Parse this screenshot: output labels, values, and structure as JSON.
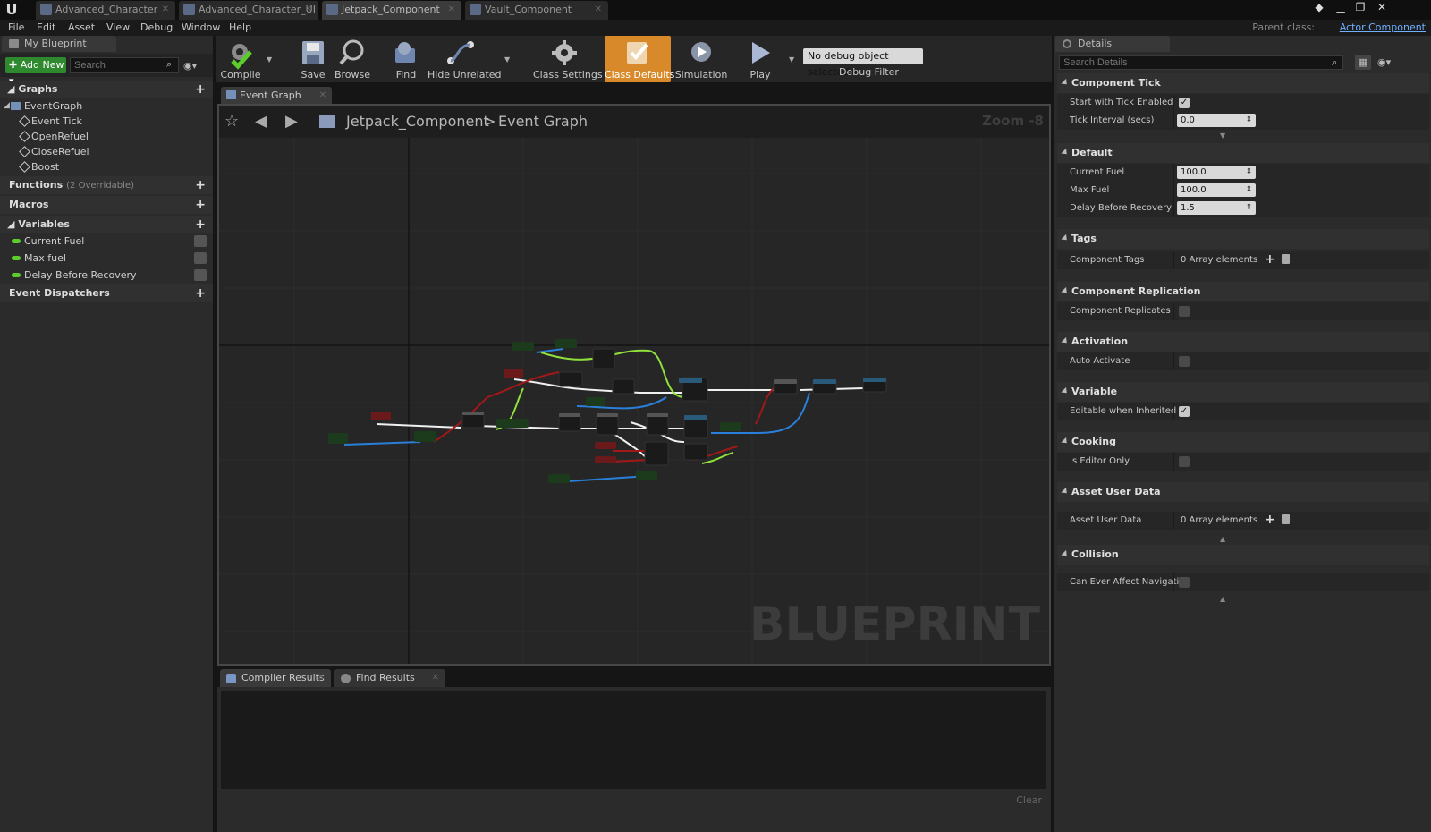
{
  "titlebar": {
    "tabs": [
      {
        "label": "Advanced_Character"
      },
      {
        "label": "Advanced_Character_UI"
      },
      {
        "label": "Jetpack_Component"
      },
      {
        "label": "Vault_Component"
      }
    ]
  },
  "menu": {
    "items": [
      "File",
      "Edit",
      "Asset",
      "View",
      "Debug",
      "Window",
      "Help"
    ],
    "parent_class_label": "Parent class:",
    "parent_class_value": "Actor Component"
  },
  "left_panel": {
    "tab_label": "My Blueprint",
    "add_new_label": "Add New",
    "search_placeholder": "Search",
    "graphs": {
      "header": "Graphs",
      "root": "EventGraph",
      "items": [
        "Event Tick",
        "OpenRefuel",
        "CloseRefuel",
        "Boost"
      ]
    },
    "functions": {
      "header": "Functions",
      "sub": "(2 Overridable)"
    },
    "macros": {
      "header": "Macros"
    },
    "variables": {
      "header": "Variables",
      "items": [
        "Current Fuel",
        "Max fuel",
        "Delay Before Recovery"
      ],
      "pill_color": "#5bcc2b"
    },
    "event_dispatchers": {
      "header": "Event Dispatchers"
    }
  },
  "toolbar": {
    "buttons": [
      {
        "label": "Compile",
        "icon": "compile-icon"
      },
      {
        "label": "Save",
        "icon": "save-icon"
      },
      {
        "label": "Browse",
        "icon": "browse-icon"
      },
      {
        "label": "Find",
        "icon": "find-icon"
      },
      {
        "label": "Hide Unrelated",
        "icon": "hide-unrelated-icon"
      },
      {
        "label": "Class Settings",
        "icon": "class-settings-icon"
      },
      {
        "label": "Class Defaults",
        "icon": "class-defaults-icon"
      },
      {
        "label": "Simulation",
        "icon": "simulation-icon"
      },
      {
        "label": "Play",
        "icon": "play-icon"
      }
    ],
    "active_button": "Class Defaults",
    "active_color": "#d88a2a",
    "debug_select": "No debug object selected",
    "debug_filter_label": "Debug Filter"
  },
  "graph": {
    "tab_label": "Event Graph",
    "breadcrumb_class": "Jetpack_Component",
    "breadcrumb_sep": ">",
    "breadcrumb_graph": "Event Graph",
    "zoom": "Zoom -8",
    "watermark": "BLUEPRINT",
    "wire_colors": {
      "exec": "#f0f0f0",
      "float": "#8fe03c",
      "object": "#2a7fd8",
      "bool": "#a01818"
    }
  },
  "bottom": {
    "tabs": [
      "Compiler Results",
      "Find Results"
    ],
    "clear_label": "Clear"
  },
  "details": {
    "tab_label": "Details",
    "search_placeholder": "Search Details",
    "categories": {
      "component_tick": {
        "header": "Component Tick",
        "start_tick_label": "Start with Tick Enabled",
        "start_tick_checked": true,
        "tick_interval_label": "Tick Interval (secs)",
        "tick_interval_value": "0.0"
      },
      "default": {
        "header": "Default",
        "current_fuel_label": "Current Fuel",
        "current_fuel_value": "100.0",
        "max_fuel_label": "Max Fuel",
        "max_fuel_value": "100.0",
        "delay_label": "Delay Before Recovery",
        "delay_value": "1.5"
      },
      "tags": {
        "header": "Tags",
        "label": "Component Tags",
        "value": "0 Array elements"
      },
      "replication": {
        "header": "Component Replication",
        "label": "Component Replicates",
        "checked": false
      },
      "activation": {
        "header": "Activation",
        "label": "Auto Activate",
        "checked": false
      },
      "variable": {
        "header": "Variable",
        "label": "Editable when Inherited",
        "checked": true
      },
      "cooking": {
        "header": "Cooking",
        "label": "Is Editor Only",
        "checked": false
      },
      "asset_user_data": {
        "header": "Asset User Data",
        "label": "Asset User Data",
        "value": "0 Array elements"
      },
      "collision": {
        "header": "Collision",
        "label": "Can Ever Affect Navigation",
        "checked": false
      }
    }
  }
}
